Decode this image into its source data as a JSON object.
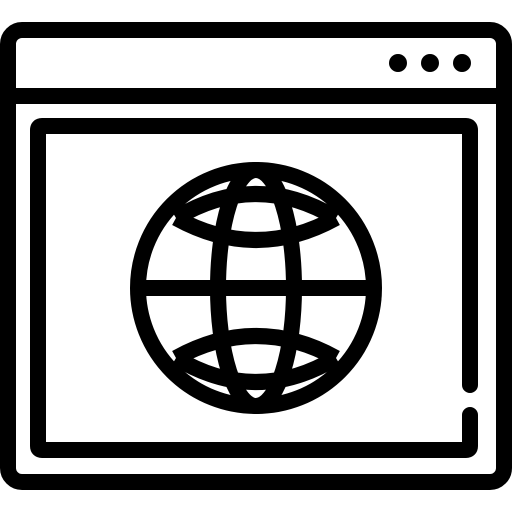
{
  "icon": {
    "name": "browser-window-globe-icon",
    "parts": {
      "window": "browser-window-frame",
      "controls": "window-control-dots",
      "content": "content-panel",
      "globe": "globe-icon"
    }
  },
  "colors": {
    "stroke": "#000000",
    "background": "#ffffff"
  },
  "window_controls": {
    "count": 3
  }
}
